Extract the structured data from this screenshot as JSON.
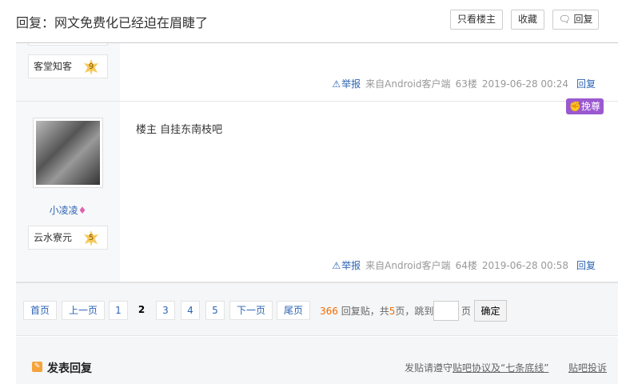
{
  "header": {
    "title": "回复：网文免费化已经迫在眉睫了",
    "only_owner": "只看楼主",
    "favorite": "收藏",
    "reply": "回复"
  },
  "posts": [
    {
      "badge": "客堂知客",
      "level": "9",
      "report": "举报",
      "source": "来自Android客户端",
      "floor": "63楼",
      "time": "2019-06-28 00:24",
      "reply": "回复"
    },
    {
      "username": "小凌凌",
      "badge": "云水寮元",
      "level": "5",
      "content": "楼主 自挂东南枝吧",
      "tag": "挽尊",
      "report": "举报",
      "source": "来自Android客户端",
      "floor": "64楼",
      "time": "2019-06-28 00:58",
      "reply": "回复"
    }
  ],
  "pager": {
    "first": "首页",
    "prev": "上一页",
    "pages": [
      "1",
      "2",
      "3",
      "4",
      "5"
    ],
    "current": "2",
    "next": "下一页",
    "last": "尾页",
    "reply_count": "366",
    "reply_label": "回复贴，共",
    "total_pages": "5",
    "pages_suffix": "页，跳到",
    "page_unit": "页",
    "confirm": "确定"
  },
  "footer": {
    "title": "发表回复",
    "notice": "发贴请遵守",
    "agreement": "贴吧协议及“七条底线”",
    "complaint": "贴吧投诉"
  },
  "colors": {
    "link": "#2d64b3",
    "accent": "#f06c00",
    "tag": "#9b59d0"
  }
}
